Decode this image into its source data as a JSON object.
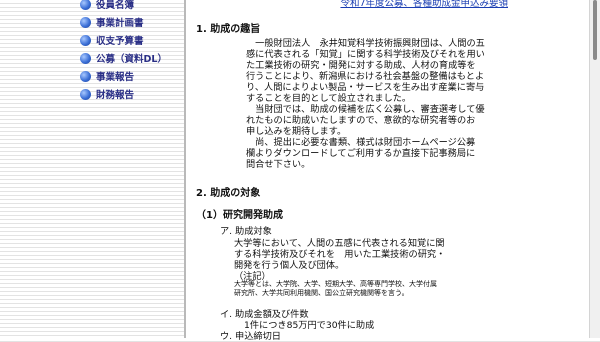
{
  "nav": {
    "items": [
      {
        "label": "役員名簿",
        "offset": -5
      },
      {
        "label": "事業計画書"
      },
      {
        "label": "収支予算書"
      },
      {
        "label": "公募（資料DL）"
      },
      {
        "label": "事業報告"
      },
      {
        "label": "財務報告"
      }
    ]
  },
  "header_link": "令和7年度公募、各種助成金申込み要領",
  "sections": {
    "s1": {
      "heading": "1. 助成の趣旨",
      "paragraph": "　一般財団法人　永井知覚科学技術振興財団は、人間の五\n感に代表される「知覚」に関する科学技術及びそれを用い\nた工業技術の研究・開発に対する助成、人材の育成等を\n行うことにより、新潟県における社会基盤の整備はもとよ\nり、人間によりよい製品・サービスを生み出す産業に寄与\nすることを目的として設立されました。\n　当財団では、助成の候補を広く公募し、審査選考して優\nれたものに助成いたしますので、意欲的な研究者等のお\n申し込みを期待します。\n　尚、提出に必要な書類、様式は財団ホームページ公募\n欄よりダウンロードしてご利用するか直接下記事務局に\n問合せ下さい。"
    },
    "s2": {
      "heading": "2. 助成の対象",
      "sub1": {
        "heading": "（1）研究開発助成",
        "a_title": "ア. 助成対象",
        "a_body": "大学等において、人間の五感に代表される知覚に関\nする科学技術及びそれを　用いた工業技術の研究・\n開発を行う個人及び団体。",
        "a_note_label": "（注記）",
        "a_note": "大学等とは、大学院、大学、短期大学、高等専門学校、大学付属\n研究所、大学共同利用機関、国公立研究機関等を言う。",
        "b_title": "イ. 助成金額及び件数",
        "b_body": "1件につき85万円で30件に助成",
        "c_title": "ウ. 申込締切日"
      }
    }
  }
}
